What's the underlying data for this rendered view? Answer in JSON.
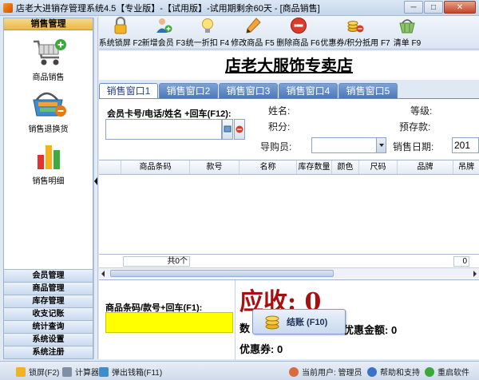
{
  "window": {
    "title": "店老大进销存管理系统4.5【专业版】-【试用版】-试用期剩余60天 - [商品销售]",
    "minimize": "─",
    "maximize": "□",
    "close": "✕"
  },
  "sidebar": {
    "header": "销售管理",
    "modules": [
      {
        "label": "商品销售",
        "icon": "shopping-cart-add-icon"
      },
      {
        "label": "销售退换货",
        "icon": "shopping-basket-return-icon"
      },
      {
        "label": "销售明细",
        "icon": "bar-chart-icon"
      }
    ],
    "menu": [
      "会员管理",
      "商品管理",
      "库存管理",
      "收支记账",
      "统计查询",
      "系统设置",
      "系统注册"
    ]
  },
  "toolbar": {
    "items": [
      {
        "label": "系统锁屏 F2",
        "icon": "padlock-icon"
      },
      {
        "label": "新增会员 F3",
        "icon": "add-member-icon"
      },
      {
        "label": "统一折扣 F4",
        "icon": "lightbulb-icon"
      },
      {
        "label": "修改商品 F5",
        "icon": "pencil-icon"
      },
      {
        "label": "删除商品 F6",
        "icon": "delete-icon"
      },
      {
        "label": "优惠券/积分抵用 F7",
        "icon": "coupon-coins-icon"
      },
      {
        "label": "清单 F9",
        "icon": "basket-list-icon"
      }
    ]
  },
  "shop_title": "店老大服饰专卖店",
  "tabs": [
    "销售窗口1",
    "销售窗口2",
    "销售窗口3",
    "销售窗口4",
    "销售窗口5"
  ],
  "member": {
    "card_label": "会员卡号/电话/姓名 +回车(F12):",
    "name_label": "姓名:",
    "level_label": "等级:",
    "points_label": "积分:",
    "deposit_label": "预存款:",
    "guide_label": "导购员:",
    "date_label": "销售日期:",
    "date_value": "201"
  },
  "grid": {
    "columns": [
      "",
      "商品条码",
      "款号",
      "名称",
      "库存数量",
      "颜色",
      "尺码",
      "品牌",
      "吊牌"
    ],
    "footer_total": "共0个",
    "footer_right": "0"
  },
  "bottom": {
    "barcode_label": "商品条码/款号+回车(F1):",
    "receivable": "应收: 0",
    "qty_label": "数",
    "discount_amount": "优惠金额: 0",
    "coupon": "优惠券: 0",
    "checkout": "结账 (F10)"
  },
  "statusbar": {
    "lock": "锁屏(F2)",
    "calculator": "计算器",
    "cash_drawer": "弹出钱箱(F11)",
    "current_user": "当前用户: 管理员",
    "help": "帮助和支持",
    "restart": "重启软件"
  },
  "colors": {
    "accent_blue": "#4c78b8",
    "header_gold": "#eab848",
    "receivable_red": "#a61010",
    "barcode_yellow": "#ffff00"
  }
}
